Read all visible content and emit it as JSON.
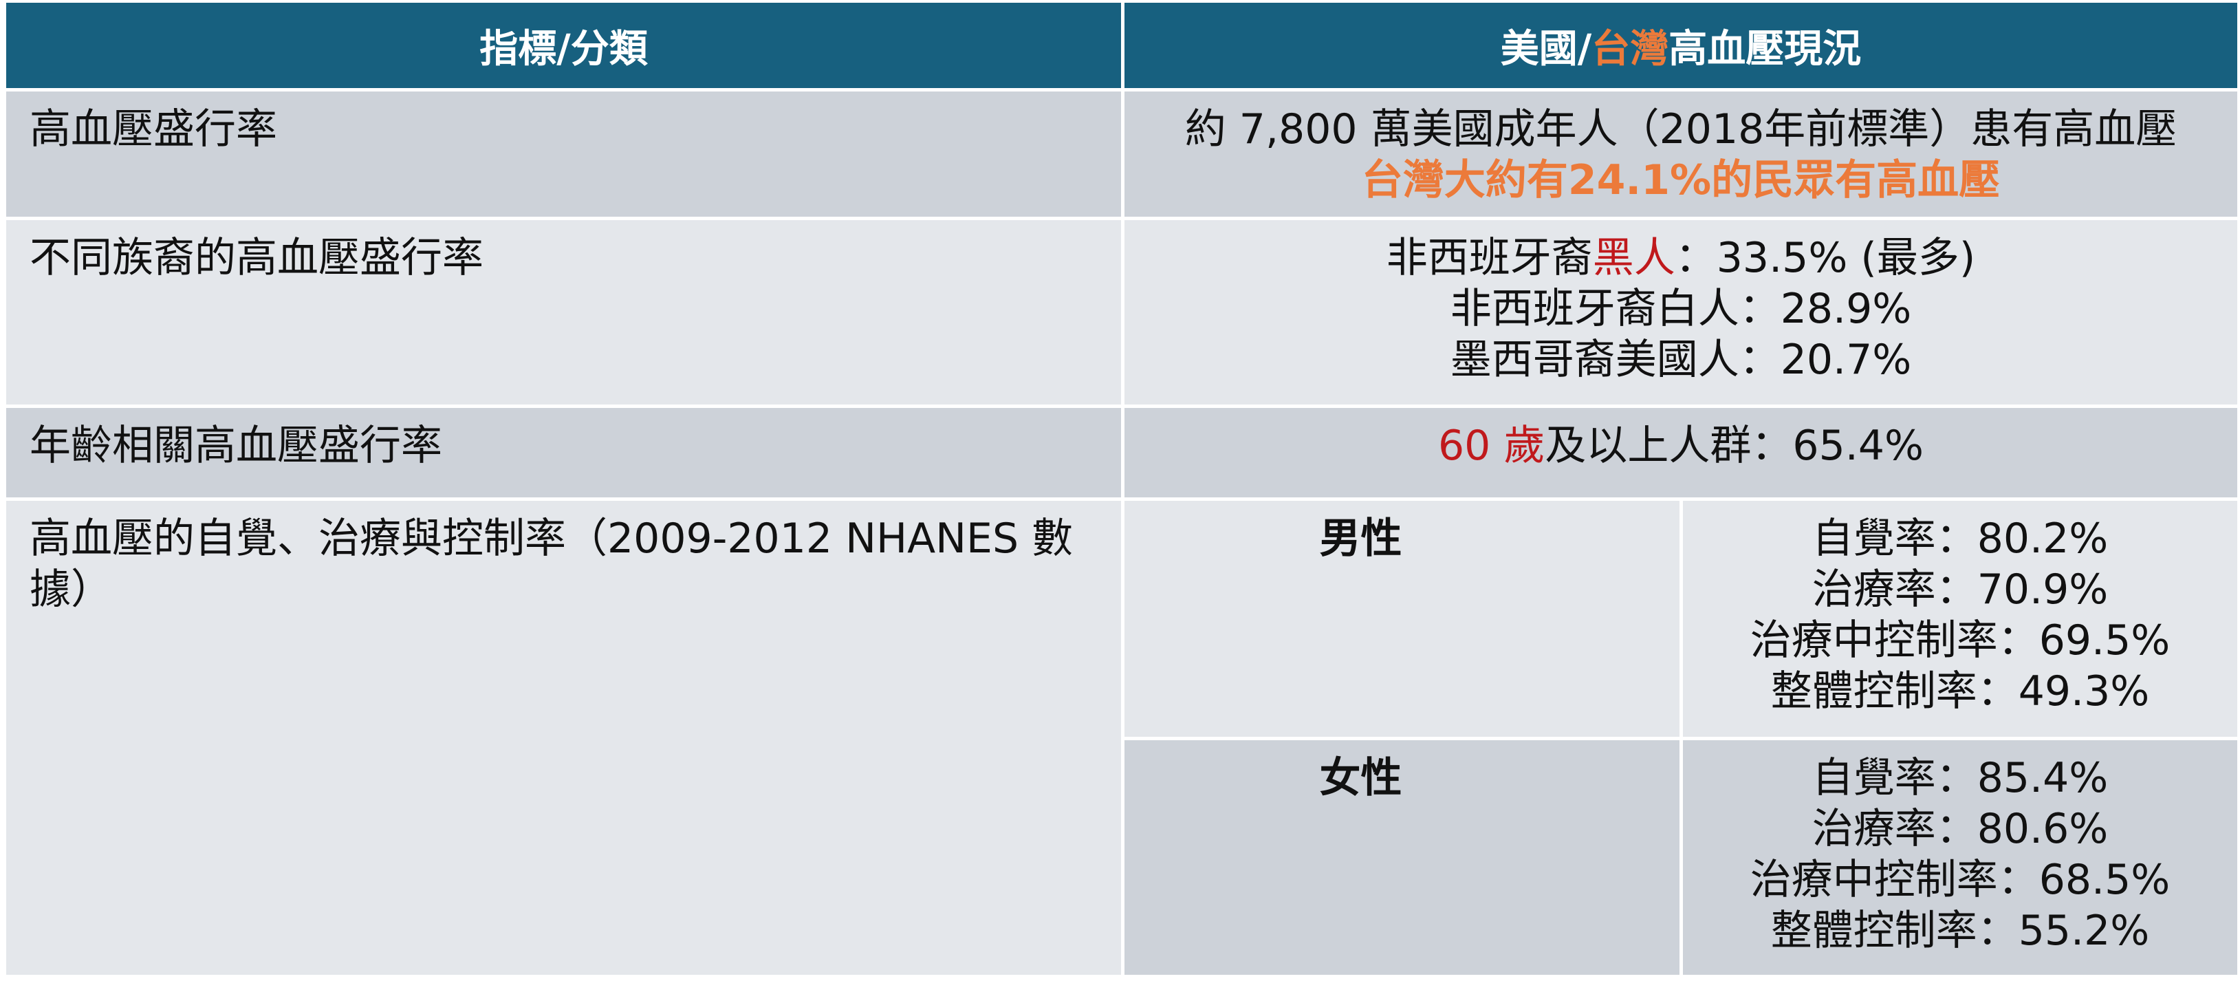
{
  "header": {
    "col1": "指標/分類",
    "col2_part1": "美國/",
    "col2_part2": "台灣",
    "col2_part3": "高血壓現況"
  },
  "rows": {
    "prevalence": {
      "label": "高血壓盛行率",
      "line1": "約 7,800 萬美國成年人（2018年前標準）患有高血壓",
      "line2": "台灣大約有24.1%的民眾有高血壓"
    },
    "ethnic": {
      "label": "不同族裔的高血壓盛行率",
      "line1_a": "非西班牙裔",
      "line1_b": "黑人",
      "line1_c": "：33.5% (最多)",
      "line2": "非西班牙裔白人：28.9%",
      "line3": "墨西哥裔美國人：20.7%"
    },
    "age": {
      "label": "年齡相關高血壓盛行率",
      "part_a": "60 歲",
      "part_b": "及以上人群：65.4%"
    },
    "awareness": {
      "label": "高血壓的自覺、治療與控制率（2009-2012 NHANES 數據）",
      "male": {
        "label": "男性",
        "lines": [
          "自覺率：80.2%",
          "治療率：70.9%",
          "治療中控制率：69.5%",
          "整體控制率：49.3%"
        ]
      },
      "female": {
        "label": "女性",
        "lines": [
          "自覺率：85.4%",
          "治療率：80.6%",
          "治療中控制率：68.5%",
          "整體控制率：55.2%"
        ]
      }
    }
  },
  "colors": {
    "header_bg": "#17607f",
    "row_dark": "#cdd2d9",
    "row_light": "#e4e7eb",
    "accent_orange": "#ec7a3a",
    "accent_red": "#c0191c"
  }
}
